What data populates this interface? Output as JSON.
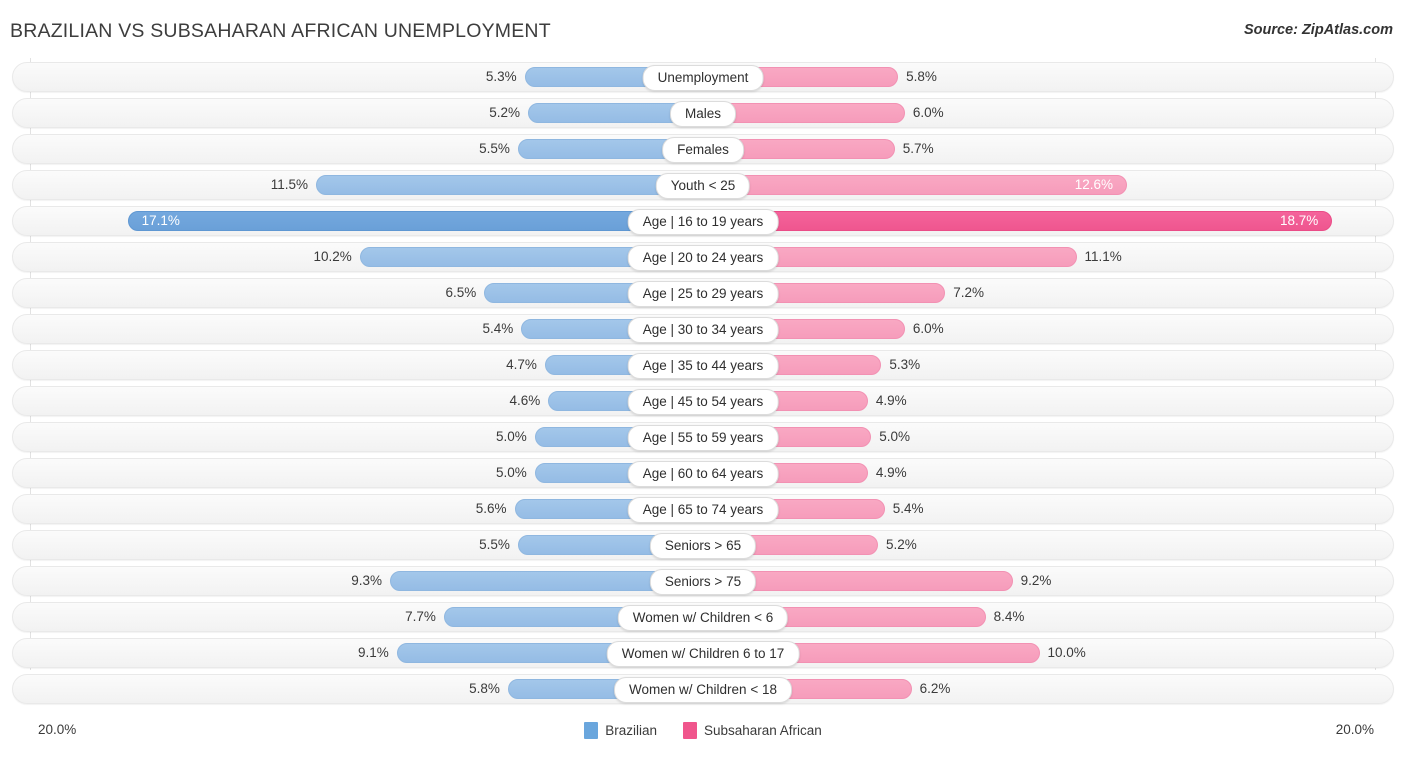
{
  "header": {
    "title": "BRAZILIAN VS SUBSAHARAN AFRICAN UNEMPLOYMENT",
    "source": "Source: ZipAtlas.com"
  },
  "legend": {
    "items": [
      {
        "label": "Brazilian",
        "color": "#6aa6dd"
      },
      {
        "label": "Subsaharan African",
        "color": "#f0558c"
      }
    ]
  },
  "axis": {
    "left_label": "20.0%",
    "right_label": "20.0%",
    "max": 20.0
  },
  "colors": {
    "left_bar": "#95bce5",
    "left_bar_max": "#6aa0d8",
    "right_bar": "#f69cbb",
    "right_bar_max": "#ef568f",
    "track": "#f2f2f2",
    "gridline": "#e2e2e2",
    "text": "#3a3a3a"
  },
  "chart_data": {
    "type": "bar",
    "title": "BRAZILIAN VS SUBSAHARAN AFRICAN UNEMPLOYMENT",
    "subtitle": "",
    "xlabel": "",
    "ylabel": "",
    "orientation": "horizontal-diverging",
    "xlim": [
      0,
      20
    ],
    "grid": true,
    "legend_position": "bottom-center",
    "categories": [
      "Unemployment",
      "Males",
      "Females",
      "Youth < 25",
      "Age | 16 to 19 years",
      "Age | 20 to 24 years",
      "Age | 25 to 29 years",
      "Age | 30 to 34 years",
      "Age | 35 to 44 years",
      "Age | 45 to 54 years",
      "Age | 55 to 59 years",
      "Age | 60 to 64 years",
      "Age | 65 to 74 years",
      "Seniors > 65",
      "Seniors > 75",
      "Women w/ Children < 6",
      "Women w/ Children 6 to 17",
      "Women w/ Children < 18"
    ],
    "series": [
      {
        "name": "Brazilian",
        "color": "#95bce5",
        "values": [
          5.3,
          5.2,
          5.5,
          11.5,
          17.1,
          10.2,
          6.5,
          5.4,
          4.7,
          4.6,
          5.0,
          5.0,
          5.6,
          5.5,
          9.3,
          7.7,
          9.1,
          5.8
        ],
        "labels": [
          "5.3%",
          "5.2%",
          "5.5%",
          "11.5%",
          "17.1%",
          "10.2%",
          "6.5%",
          "5.4%",
          "4.7%",
          "4.6%",
          "5.0%",
          "5.0%",
          "5.6%",
          "5.5%",
          "9.3%",
          "7.7%",
          "9.1%",
          "5.8%"
        ]
      },
      {
        "name": "Subsaharan African",
        "color": "#f69cbb",
        "values": [
          5.8,
          6.0,
          5.7,
          12.6,
          18.7,
          11.1,
          7.2,
          6.0,
          5.3,
          4.9,
          5.0,
          4.9,
          5.4,
          5.2,
          9.2,
          8.4,
          10.0,
          6.2
        ],
        "labels": [
          "5.8%",
          "6.0%",
          "5.7%",
          "12.6%",
          "18.7%",
          "11.1%",
          "7.2%",
          "6.0%",
          "5.3%",
          "4.9%",
          "5.0%",
          "4.9%",
          "5.4%",
          "5.2%",
          "9.2%",
          "8.4%",
          "10.0%",
          "6.2%"
        ]
      }
    ]
  }
}
